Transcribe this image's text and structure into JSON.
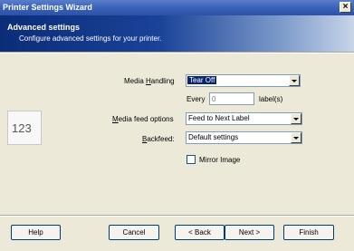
{
  "window": {
    "title": "Printer Settings Wizard",
    "close_glyph": "×"
  },
  "header": {
    "title": "Advanced settings",
    "subtitle": "Configure advanced settings for your printer."
  },
  "preview": {
    "text": "123"
  },
  "form": {
    "media_handling": {
      "label_pre": "Media ",
      "label_accel": "H",
      "label_post": "andling",
      "value": "Tear Off"
    },
    "every": {
      "label": "Every",
      "value": "0",
      "suffix": "label(s)"
    },
    "media_feed": {
      "label_accel": "M",
      "label_post": "edia feed options",
      "value": "Feed to Next Label"
    },
    "backfeed": {
      "label_accel": "B",
      "label_post": "ackfeed:",
      "value": "Default settings"
    },
    "mirror_image": {
      "label": "Mirror Image",
      "checked": false
    }
  },
  "buttons": {
    "help": "Help",
    "cancel": "Cancel",
    "back": "< Back",
    "next": "Next >",
    "finish": "Finish"
  }
}
